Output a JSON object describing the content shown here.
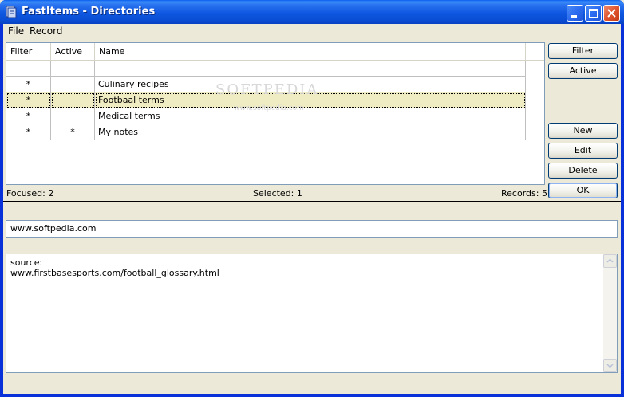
{
  "window": {
    "title": "FastItems - Directories"
  },
  "menu": {
    "items": [
      "File",
      "Record"
    ]
  },
  "grid": {
    "columns": [
      "Filter",
      "Active",
      "Name"
    ],
    "rows": [
      {
        "filter": "",
        "active": "",
        "name": ""
      },
      {
        "filter": "*",
        "active": "",
        "name": "Culinary recipes"
      },
      {
        "filter": "*",
        "active": "",
        "name": "Footbaal terms"
      },
      {
        "filter": "*",
        "active": "",
        "name": "Medical terms"
      },
      {
        "filter": "*",
        "active": "*",
        "name": "My notes"
      }
    ],
    "selected_row": 2
  },
  "status": {
    "focused": "Focused: 2",
    "selected": "Selected: 1",
    "records": "Records: 5"
  },
  "buttons": {
    "filter": "Filter",
    "active": "Active",
    "new": "New",
    "edit": "Edit",
    "delete": "Delete",
    "ok": "OK"
  },
  "detail": {
    "url": "www.softpedia.com",
    "memo_line1": "source:",
    "memo_line2": "www.firstbasesports.com/football_glossary.html"
  },
  "watermark": {
    "brand": "SOFTPEDIA",
    "url": "www.softpedia.com"
  },
  "colors": {
    "titlebar": "#0a4fd6",
    "selected_row": "#efebc2",
    "face": "#ece9d8"
  }
}
